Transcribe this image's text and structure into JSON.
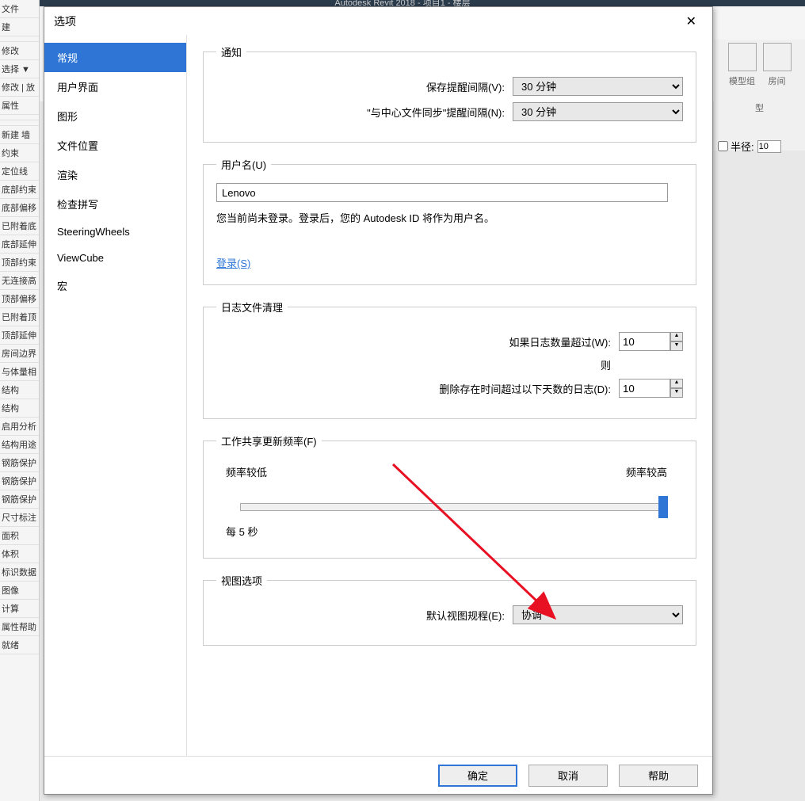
{
  "app": {
    "title": "Autodesk Revit 2018 -   项目1 - 楼层"
  },
  "bg": {
    "left_items": [
      "文件",
      "建",
      "",
      "修改",
      "选择 ▼",
      "修改 | 放",
      "属性",
      "",
      "",
      "新建 墙",
      "约束",
      "定位线",
      "底部约束",
      "底部偏移",
      "已附着底",
      "底部延伸",
      "顶部约束",
      "无连接高",
      "顶部偏移",
      "已附着顶",
      "顶部延伸",
      "房间边界",
      "与体量相",
      "结构",
      "结构",
      "启用分析",
      "结构用途",
      "钢筋保护",
      "钢筋保护",
      "钢筋保护",
      "尺寸标注",
      "面积",
      "体积",
      "标识数据",
      "图像",
      "计算",
      "属性帮助",
      "就绪"
    ],
    "right": {
      "model_group": "模型组",
      "room": "房间",
      "type": "型"
    },
    "radius": {
      "label": "半径:",
      "value": "10"
    }
  },
  "dialog": {
    "title": "选项",
    "sidebar": [
      "常规",
      "用户界面",
      "图形",
      "文件位置",
      "渲染",
      "检查拼写",
      "SteeringWheels",
      "ViewCube",
      "宏"
    ],
    "notify": {
      "legend": "通知",
      "save_label": "保存提醒间隔(V):",
      "save_value": "30 分钟",
      "sync_label": "\"与中心文件同步\"提醒间隔(N):",
      "sync_value": "30 分钟"
    },
    "user": {
      "legend": "用户名(U)",
      "value": "Lenovo",
      "note": "您当前尚未登录。登录后，您的 Autodesk ID 将作为用户名。",
      "login": "登录(S)"
    },
    "log": {
      "legend": "日志文件清理",
      "count_label": "如果日志数量超过(W):",
      "count_value": "10",
      "then": "则",
      "days_label": "删除存在时间超过以下天数的日志(D):",
      "days_value": "10"
    },
    "freq": {
      "legend": "工作共享更新频率(F)",
      "low": "频率较低",
      "high": "频率较高",
      "value": "每 5 秒"
    },
    "view": {
      "legend": "视图选项",
      "label": "默认视图规程(E):",
      "value": "协调"
    },
    "buttons": {
      "ok": "确定",
      "cancel": "取消",
      "help": "帮助"
    }
  }
}
